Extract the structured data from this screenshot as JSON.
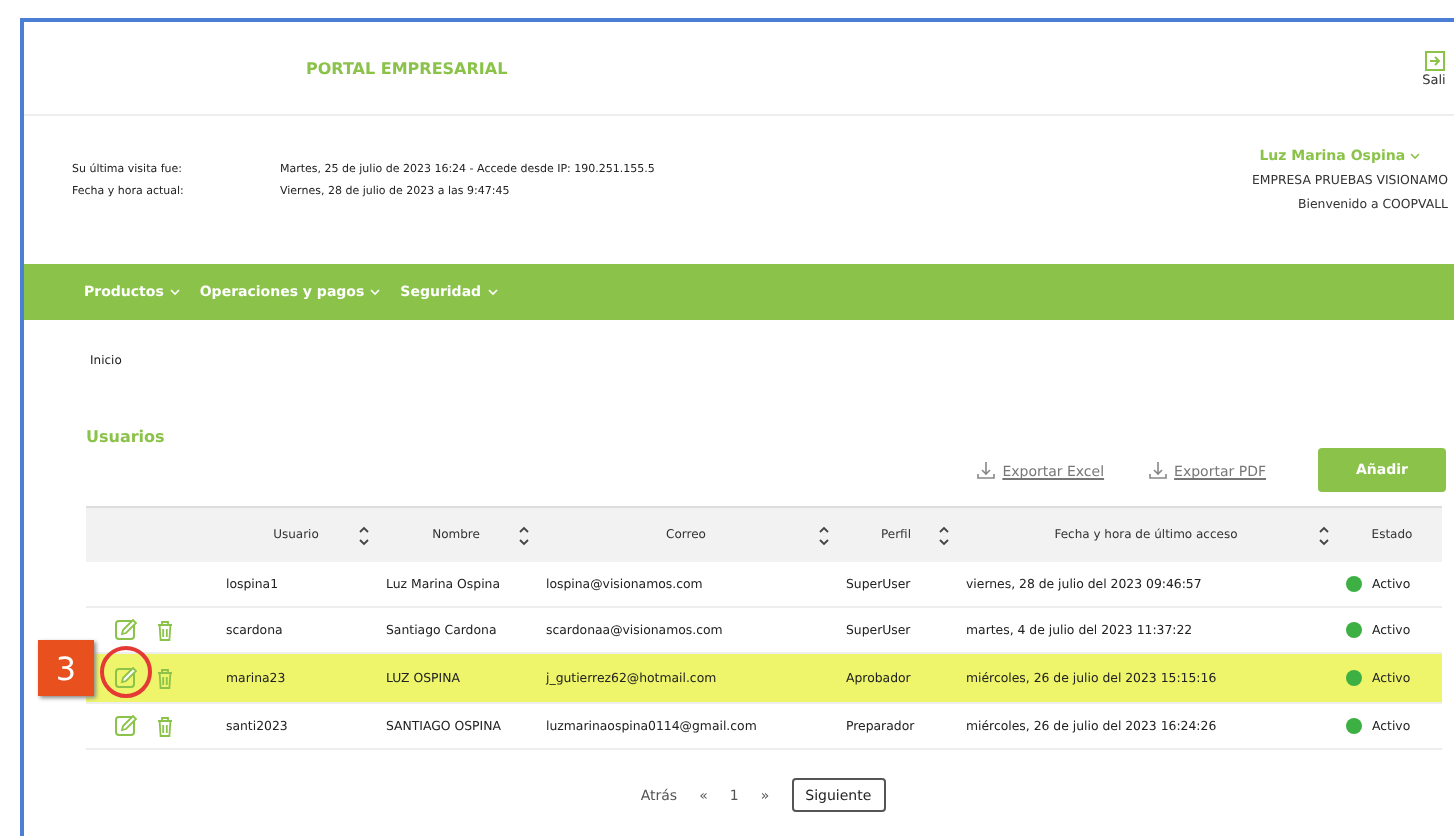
{
  "header": {
    "title": "PORTAL EMPRESARIAL",
    "exit_label": "Sali"
  },
  "session": {
    "last_visit_label": "Su última visita fue:",
    "last_visit_value": "Martes, 25 de julio de 2023 16:24 - Accede desde IP: 190.251.155.5",
    "now_label": "Fecha y hora actual:",
    "now_value": "Viernes, 28 de julio de 2023 a las 9:47:45",
    "user_name": "Luz Marina Ospina",
    "company": "EMPRESA PRUEBAS VISIONAMO",
    "welcome": "Bienvenido a COOPVALL"
  },
  "nav": [
    {
      "label": "Productos"
    },
    {
      "label": "Operaciones y pagos"
    },
    {
      "label": "Seguridad"
    }
  ],
  "breadcrumb": "Inicio",
  "section_title": "Usuarios",
  "actions": {
    "export_excel": "Exportar Excel",
    "export_pdf": "Exportar PDF",
    "add": "Añadir"
  },
  "table": {
    "columns": [
      {
        "label": "Usuario",
        "sortable": true
      },
      {
        "label": "Nombre",
        "sortable": true
      },
      {
        "label": "Correo",
        "sortable": true
      },
      {
        "label": "Perfil",
        "sortable": true
      },
      {
        "label": "Fecha y hora de último acceso",
        "sortable": true
      },
      {
        "label": "Estado",
        "sortable": false
      }
    ],
    "rows": [
      {
        "cells": [
          "lospina1",
          "Luz Marina Ospina",
          "lospina@visionamos.com",
          "SuperUser",
          "viernes, 28 de julio del 2023 09:46:57"
        ],
        "status": "Activo",
        "actions": false,
        "selected": false
      },
      {
        "cells": [
          "scardona",
          "Santiago Cardona",
          "scardonaa@visionamos.com",
          "SuperUser",
          "martes, 4 de julio del 2023 11:37:22"
        ],
        "status": "Activo",
        "actions": true,
        "selected": false
      },
      {
        "cells": [
          "marina23",
          "LUZ OSPINA",
          "j_gutierrez62@hotmail.com",
          "Aprobador",
          "miércoles, 26 de julio del 2023 15:15:16"
        ],
        "status": "Activo",
        "actions": true,
        "selected": true
      },
      {
        "cells": [
          "santi2023",
          "SANTIAGO OSPINA",
          "luzmarinaospina0114@gmail.com",
          "Preparador",
          "miércoles, 26 de julio del 2023 16:24:26"
        ],
        "status": "Activo",
        "actions": true,
        "selected": false
      }
    ]
  },
  "callout": {
    "label": "3"
  },
  "pagination": {
    "prev": "Atrás",
    "first": "«",
    "page": "1",
    "last": "»",
    "next": "Siguiente"
  }
}
